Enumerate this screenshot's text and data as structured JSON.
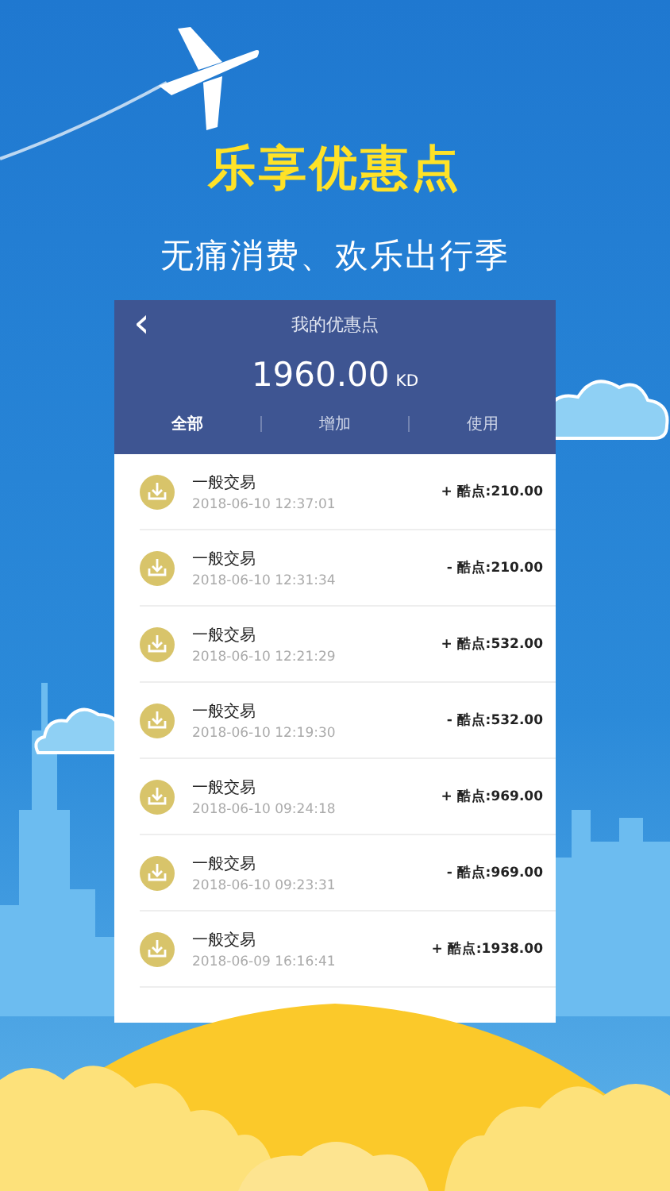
{
  "headline": "乐享优惠点",
  "subtitle": "无痛消费、欢乐出行季",
  "screen": {
    "title": "我的优惠点",
    "back": "‹",
    "balance": "1960.00",
    "unit": "KD",
    "tabs": [
      {
        "label": "全部",
        "selected": true
      },
      {
        "label": "增加",
        "selected": false
      },
      {
        "label": "使用",
        "selected": false
      }
    ],
    "transactions": [
      {
        "title": "一般交易",
        "time": "2018-06-10 12:37:01",
        "amount": "+ 酷点:210.00"
      },
      {
        "title": "一般交易",
        "time": "2018-06-10 12:31:34",
        "amount": "- 酷点:210.00"
      },
      {
        "title": "一般交易",
        "time": "2018-06-10 12:21:29",
        "amount": "+ 酷点:532.00"
      },
      {
        "title": "一般交易",
        "time": "2018-06-10 12:19:30",
        "amount": "- 酷点:532.00"
      },
      {
        "title": "一般交易",
        "time": "2018-06-10 09:24:18",
        "amount": "+ 酷点:969.00"
      },
      {
        "title": "一般交易",
        "time": "2018-06-10 09:23:31",
        "amount": "- 酷点:969.00"
      },
      {
        "title": "一般交易",
        "time": "2018-06-09 16:16:41",
        "amount": "+ 酷点:1938.00"
      }
    ]
  }
}
